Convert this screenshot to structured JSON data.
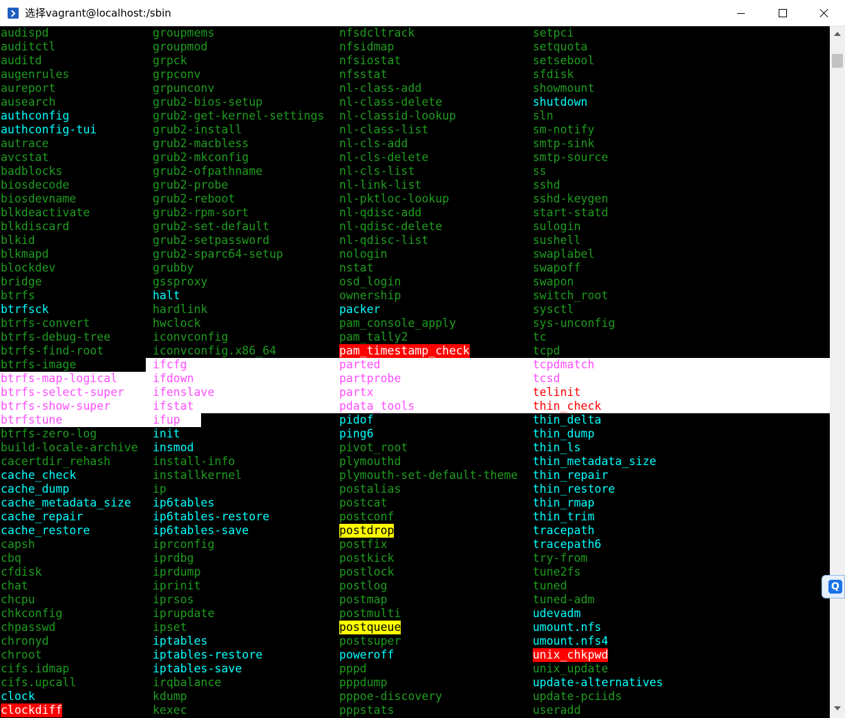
{
  "window": {
    "title": "选择vagrant@localhost:/sbin"
  },
  "colors": {
    "terminal_bg": "#000000",
    "executable_green": "#1f9d1f",
    "symlink_cyan": "#00ffff",
    "magenta": "#ff4dff",
    "red": "#ff0000",
    "highlight_red_bg": "#ff0000",
    "highlight_yellow_bg": "#ffff00",
    "white": "#ffffff"
  },
  "icons": {
    "app": "powershell-icon",
    "minimize": "minimize-icon",
    "maximize": "maximize-icon",
    "close": "close-icon",
    "float": "q-search-icon"
  },
  "terminal": {
    "rows": [
      [
        "audispd",
        "groupmems",
        "nfsdcltrack",
        "setpci"
      ],
      [
        "auditctl",
        "groupmod",
        "nfsidmap",
        "setquota"
      ],
      [
        "auditd",
        "grpck",
        "nfsiostat",
        "setsebool"
      ],
      [
        "augenrules",
        "grpconv",
        "nfsstat",
        "sfdisk"
      ],
      [
        "aureport",
        "grpunconv",
        "nl-class-add",
        "showmount"
      ],
      [
        "ausearch",
        "grub2-bios-setup",
        "nl-class-delete",
        "shutdown"
      ],
      [
        "authconfig",
        "grub2-get-kernel-settings",
        "nl-classid-lookup",
        "sln"
      ],
      [
        "authconfig-tui",
        "grub2-install",
        "nl-class-list",
        "sm-notify"
      ],
      [
        "autrace",
        "grub2-macbless",
        "nl-cls-add",
        "smtp-sink"
      ],
      [
        "avcstat",
        "grub2-mkconfig",
        "nl-cls-delete",
        "smtp-source"
      ],
      [
        "badblocks",
        "grub2-ofpathname",
        "nl-cls-list",
        "ss"
      ],
      [
        "biosdecode",
        "grub2-probe",
        "nl-link-list",
        "sshd"
      ],
      [
        "biosdevname",
        "grub2-reboot",
        "nl-pktloc-lookup",
        "sshd-keygen"
      ],
      [
        "blkdeactivate",
        "grub2-rpm-sort",
        "nl-qdisc-add",
        "start-statd"
      ],
      [
        "blkdiscard",
        "grub2-set-default",
        "nl-qdisc-delete",
        "sulogin"
      ],
      [
        "blkid",
        "grub2-setpassword",
        "nl-qdisc-list",
        "sushell"
      ],
      [
        "blkmapd",
        "grub2-sparc64-setup",
        "nologin",
        "swaplabel"
      ],
      [
        "blockdev",
        "grubby",
        "nstat",
        "swapoff"
      ],
      [
        "bridge",
        "gssproxy",
        "osd_login",
        "swapon"
      ],
      [
        "btrfs",
        "halt",
        "ownership",
        "switch_root"
      ],
      [
        "btrfsck",
        "hardlink",
        "packer",
        "sysctl"
      ],
      [
        "btrfs-convert",
        "hwclock",
        "pam_console_apply",
        "sys-unconfig"
      ],
      [
        "btrfs-debug-tree",
        "iconvconfig",
        "pam_tally2",
        "tc"
      ],
      [
        "btrfs-find-root",
        "iconvconfig.x86_64",
        "pam_timestamp_check",
        "tcpd"
      ],
      [
        "btrfs-image",
        "ifcfg",
        "parted",
        "tcpdmatch"
      ],
      [
        "btrfs-map-logical",
        "ifdown",
        "partprobe",
        "tcsd"
      ],
      [
        "btrfs-select-super",
        "ifenslave",
        "partx",
        "telinit"
      ],
      [
        "btrfs-show-super",
        "ifstat",
        "pdata_tools",
        "thin_check"
      ],
      [
        "btrfstune",
        "ifup",
        "pidof",
        "thin_delta"
      ],
      [
        "btrfs-zero-log",
        "init",
        "ping6",
        "thin_dump"
      ],
      [
        "build-locale-archive",
        "insmod",
        "pivot_root",
        "thin_ls"
      ],
      [
        "cacertdir_rehash",
        "install-info",
        "plymouthd",
        "thin_metadata_size"
      ],
      [
        "cache_check",
        "installkernel",
        "plymouth-set-default-theme",
        "thin_repair"
      ],
      [
        "cache_dump",
        "ip",
        "postalias",
        "thin_restore"
      ],
      [
        "cache_metadata_size",
        "ip6tables",
        "postcat",
        "thin_rmap"
      ],
      [
        "cache_repair",
        "ip6tables-restore",
        "postconf",
        "thin_trim"
      ],
      [
        "cache_restore",
        "ip6tables-save",
        "postdrop",
        "tracepath"
      ],
      [
        "capsh",
        "iprconfig",
        "postfix",
        "tracepath6"
      ],
      [
        "cbq",
        "iprdbg",
        "postkick",
        "try-from"
      ],
      [
        "cfdisk",
        "iprdump",
        "postlock",
        "tune2fs"
      ],
      [
        "chat",
        "iprinit",
        "postlog",
        "tuned"
      ],
      [
        "chcpu",
        "iprsos",
        "postmap",
        "tuned-adm"
      ],
      [
        "chkconfig",
        "iprupdate",
        "postmulti",
        "udevadm"
      ],
      [
        "chpasswd",
        "ipset",
        "postqueue",
        "umount.nfs"
      ],
      [
        "chronyd",
        "iptables",
        "postsuper",
        "umount.nfs4"
      ],
      [
        "chroot",
        "iptables-restore",
        "poweroff",
        "unix_chkpwd"
      ],
      [
        "cifs.idmap",
        "iptables-save",
        "pppd",
        "unix_update"
      ],
      [
        "cifs.upcall",
        "irqbalance",
        "pppdump",
        "update-alternatives"
      ],
      [
        "clock",
        "kdump",
        "pppoe-discovery",
        "update-pciids"
      ],
      [
        "clockdiff",
        "kexec",
        "pppstats",
        "useradd"
      ]
    ],
    "styles": [
      [
        "g",
        "g",
        "g",
        "g"
      ],
      [
        "g",
        "g",
        "g",
        "g"
      ],
      [
        "g",
        "g",
        "g",
        "g"
      ],
      [
        "g",
        "g",
        "g",
        "g"
      ],
      [
        "g",
        "g",
        "g",
        "g"
      ],
      [
        "g",
        "g",
        "g",
        "c"
      ],
      [
        "c",
        "g",
        "g",
        "g"
      ],
      [
        "c",
        "g",
        "g",
        "g"
      ],
      [
        "g",
        "g",
        "g",
        "g"
      ],
      [
        "g",
        "g",
        "g",
        "g"
      ],
      [
        "g",
        "g",
        "g",
        "g"
      ],
      [
        "g",
        "g",
        "g",
        "g"
      ],
      [
        "g",
        "g",
        "g",
        "g"
      ],
      [
        "g",
        "g",
        "g",
        "g"
      ],
      [
        "g",
        "g",
        "g",
        "g"
      ],
      [
        "g",
        "g",
        "g",
        "g"
      ],
      [
        "g",
        "g",
        "g",
        "g"
      ],
      [
        "g",
        "g",
        "g",
        "g"
      ],
      [
        "g",
        "g",
        "g",
        "g"
      ],
      [
        "g",
        "c",
        "g",
        "g"
      ],
      [
        "c",
        "g",
        "c",
        "g"
      ],
      [
        "g",
        "g",
        "g",
        "g"
      ],
      [
        "g",
        "g",
        "g",
        "g"
      ],
      [
        "g",
        "g",
        "hr",
        "g"
      ],
      [
        "g",
        "m",
        "m",
        "m"
      ],
      [
        "m",
        "m",
        "m",
        "m"
      ],
      [
        "m",
        "m",
        "m",
        "r"
      ],
      [
        "m",
        "m",
        "m",
        "r"
      ],
      [
        "m",
        "m",
        "c",
        "c"
      ],
      [
        "g",
        "c",
        "c",
        "c"
      ],
      [
        "g",
        "c",
        "g",
        "c"
      ],
      [
        "g",
        "g",
        "g",
        "c"
      ],
      [
        "c",
        "g",
        "g",
        "c"
      ],
      [
        "c",
        "g",
        "g",
        "c"
      ],
      [
        "c",
        "c",
        "g",
        "c"
      ],
      [
        "c",
        "c",
        "g",
        "c"
      ],
      [
        "c",
        "c",
        "hy",
        "c"
      ],
      [
        "g",
        "g",
        "g",
        "c"
      ],
      [
        "g",
        "g",
        "g",
        "g"
      ],
      [
        "g",
        "g",
        "g",
        "g"
      ],
      [
        "g",
        "g",
        "g",
        "g"
      ],
      [
        "g",
        "g",
        "g",
        "g"
      ],
      [
        "g",
        "g",
        "g",
        "c"
      ],
      [
        "g",
        "g",
        "hy",
        "c"
      ],
      [
        "g",
        "c",
        "g",
        "c"
      ],
      [
        "g",
        "c",
        "c",
        "hr"
      ],
      [
        "g",
        "c",
        "g",
        "g"
      ],
      [
        "g",
        "g",
        "g",
        "c"
      ],
      [
        "c",
        "g",
        "g",
        "g"
      ],
      [
        "hr",
        "g",
        "g",
        "g"
      ]
    ]
  }
}
